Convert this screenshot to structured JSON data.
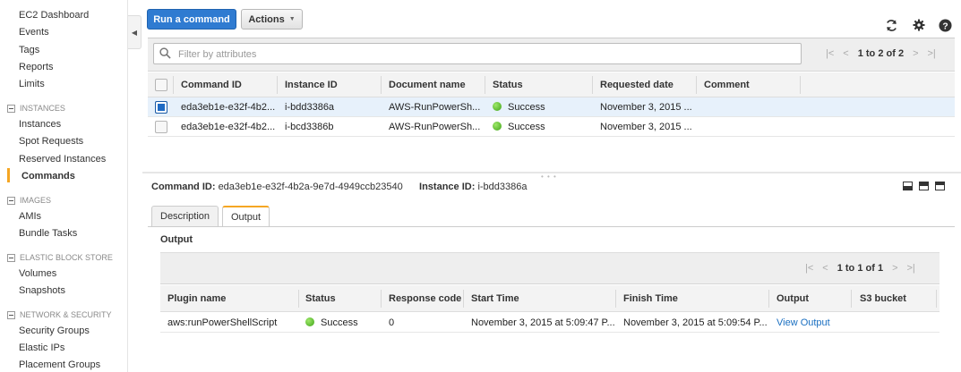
{
  "sidebar": {
    "items": [
      {
        "label": "EC2 Dashboard"
      },
      {
        "label": "Events"
      },
      {
        "label": "Tags"
      },
      {
        "label": "Reports"
      },
      {
        "label": "Limits"
      }
    ],
    "sections": [
      {
        "title": "INSTANCES",
        "items": [
          "Instances",
          "Spot Requests",
          "Reserved Instances",
          "Commands"
        ]
      },
      {
        "title": "IMAGES",
        "items": [
          "AMIs",
          "Bundle Tasks"
        ]
      },
      {
        "title": "ELASTIC BLOCK STORE",
        "items": [
          "Volumes",
          "Snapshots"
        ]
      },
      {
        "title": "NETWORK & SECURITY",
        "items": [
          "Security Groups",
          "Elastic IPs",
          "Placement Groups"
        ]
      }
    ],
    "active_item": "Commands"
  },
  "toolbar": {
    "run_label": "Run a command",
    "actions_label": "Actions"
  },
  "filter": {
    "placeholder": "Filter by attributes",
    "pager_text": "1 to 2 of 2"
  },
  "commands_table": {
    "headers": [
      "Command ID",
      "Instance ID",
      "Document name",
      "Status",
      "Requested date",
      "Comment"
    ],
    "rows": [
      {
        "command_id": "eda3eb1e-e32f-4b2...",
        "instance_id": "i-bdd3386a",
        "document": "AWS-RunPowerSh...",
        "status": "Success",
        "requested": "November 3, 2015 ...",
        "comment": "",
        "selected": true
      },
      {
        "command_id": "eda3eb1e-e32f-4b2...",
        "instance_id": "i-bcd3386b",
        "document": "AWS-RunPowerSh...",
        "status": "Success",
        "requested": "November 3, 2015 ...",
        "comment": "",
        "selected": false
      }
    ]
  },
  "detail": {
    "command_id_label": "Command ID:",
    "command_id_value": "eda3eb1e-e32f-4b2a-9e7d-4949ccb23540",
    "instance_id_label": "Instance ID:",
    "instance_id_value": "i-bdd3386a",
    "tabs": [
      "Description",
      "Output"
    ],
    "active_tab": "Output",
    "section_title": "Output",
    "pager_text": "1 to 1 of 1"
  },
  "output_table": {
    "headers": [
      "Plugin name",
      "Status",
      "Response code",
      "Start Time",
      "Finish Time",
      "Output",
      "S3 bucket"
    ],
    "rows": [
      {
        "plugin": "aws:runPowerShellScript",
        "status": "Success",
        "response_code": "0",
        "start": "November 3, 2015 at 5:09:47 P...",
        "finish": "November 3, 2015 at 5:09:54 P...",
        "output": "View Output",
        "s3": ""
      }
    ]
  },
  "colors": {
    "primary_button": "#2f7bd1",
    "active_accent": "#f5a623",
    "success": "#3fa318",
    "link": "#1a6fc1"
  }
}
